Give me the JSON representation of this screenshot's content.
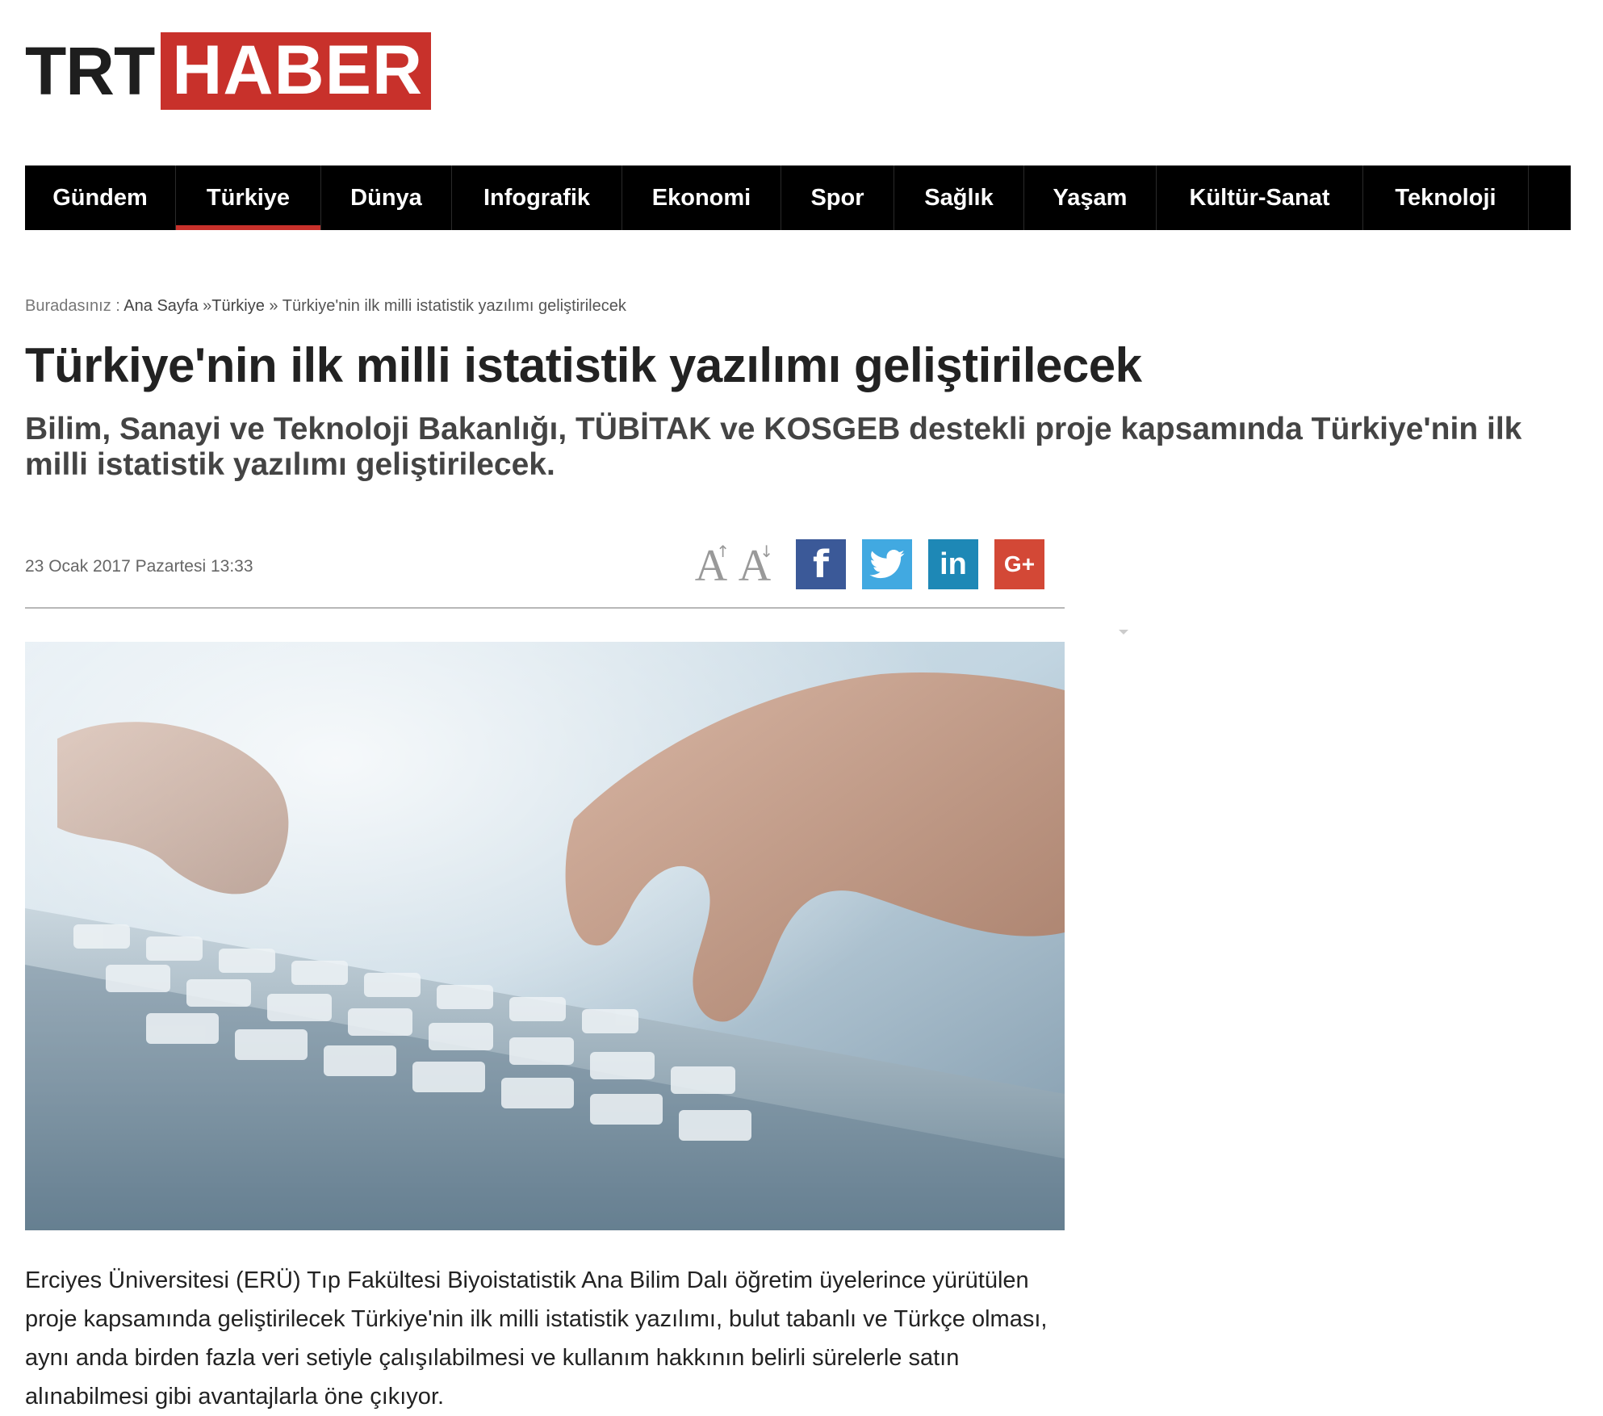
{
  "logo": {
    "part1": "TRT",
    "part2": "HABER",
    "accent_color": "#c8312b"
  },
  "nav": {
    "items": [
      {
        "label": "Gündem",
        "active": false
      },
      {
        "label": "Türkiye",
        "active": true
      },
      {
        "label": "Dünya",
        "active": false
      },
      {
        "label": "Infografik",
        "active": false
      },
      {
        "label": "Ekonomi",
        "active": false
      },
      {
        "label": "Spor",
        "active": false
      },
      {
        "label": "Sağlık",
        "active": false
      },
      {
        "label": "Yaşam",
        "active": false
      },
      {
        "label": "Kültür-Sanat",
        "active": false
      },
      {
        "label": "Teknoloji",
        "active": false
      }
    ]
  },
  "breadcrumb": {
    "prefix": "Buradasınız :",
    "home": "Ana Sayfa",
    "sep1": "»",
    "category": "Türkiye",
    "sep2": "»",
    "current": "Türkiye'nin ilk milli istatistik yazılımı geliştirilecek"
  },
  "article": {
    "title": "Türkiye'nin ilk milli istatistik yazılımı geliştirilecek",
    "spot": "Bilim, Sanayi ve Teknoloji Bakanlığı, TÜBİTAK ve KOSGEB destekli proje kapsamında Türkiye'nin ilk milli istatistik yazılımı geliştirilecek.",
    "date": "23 Ocak 2017 Pazartesi 13:33",
    "body": "Erciyes Üniversitesi (ERÜ) Tıp Fakültesi Biyoistatistik Ana Bilim Dalı öğretim üyelerince yürütülen proje kapsamında geliştirilecek Türkiye'nin ilk milli istatistik yazılımı, bulut tabanlı ve Türkçe olması, aynı anda birden fazla veri setiyle çalışılabilmesi ve kullanım hakkının belirli sürelerle satın alınabilmesi gibi avantajlarla öne çıkıyor."
  },
  "tools": {
    "font_increase_glyph": "A",
    "font_increase_arrow": "↑",
    "font_decrease_glyph": "A",
    "font_decrease_arrow": "↓",
    "facebook": {
      "glyph": "f",
      "color": "#3b5998"
    },
    "twitter": {
      "color": "#41a9e1"
    },
    "linkedin": {
      "glyph": "in",
      "color": "#1e88b6"
    },
    "googleplus": {
      "glyph": "G+",
      "color": "#d34836"
    }
  }
}
